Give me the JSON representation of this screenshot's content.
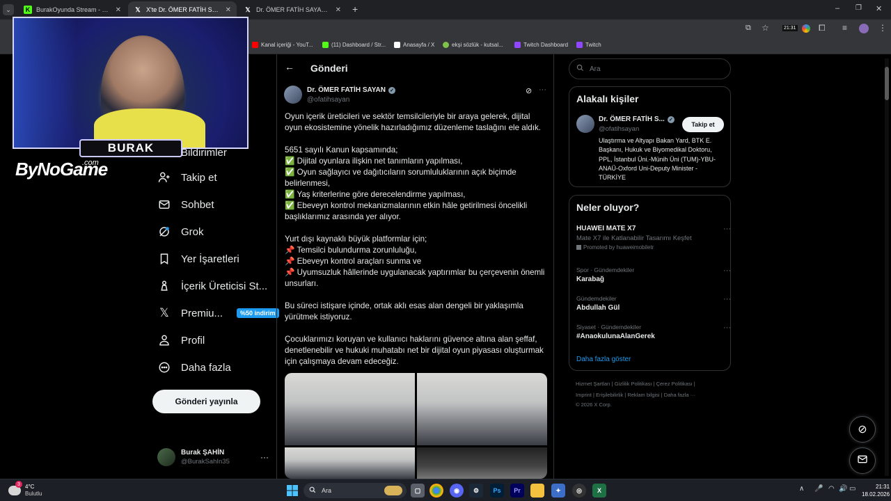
{
  "browser": {
    "tabs": [
      {
        "title": "BurakOyunda Stream - Watch L",
        "favicon": "twitch-kick-icon",
        "active": false
      },
      {
        "title": "X'te Dr. ÖMER FATİH SAYAN: \"O",
        "favicon": "x-logo-icon",
        "active": true
      },
      {
        "title": "Dr. ÖMER FATİH SAYAN (@ofat",
        "favicon": "x-logo-icon",
        "active": false
      }
    ],
    "new_tab": "+",
    "clock_badge": "21:31",
    "bookmarks": [
      {
        "label": "Kanal içeriği - YouT...",
        "color": "#ff0000"
      },
      {
        "label": "(11) Dashboard / Str...",
        "color": "#53fc18"
      },
      {
        "label": "Anasayfa / X",
        "color": "#ffffff"
      },
      {
        "label": "ekşi sözlük - kutsal...",
        "color": "#81c14b"
      },
      {
        "label": "Twitch Dashboard",
        "color": "#9146ff"
      },
      {
        "label": "Twitch",
        "color": "#9146ff"
      }
    ]
  },
  "sidebar": {
    "items": [
      {
        "label": "Takip et",
        "icon": "add-person-icon"
      },
      {
        "label": "Sohbet",
        "icon": "mail-icon"
      },
      {
        "label": "Grok",
        "icon": "grok-icon"
      },
      {
        "label": "Yer İşaretleri",
        "icon": "bookmark-icon"
      },
      {
        "label": "İçerik Üreticisi St...",
        "icon": "creator-studio-icon"
      },
      {
        "label": "Premiu...",
        "icon": "x-logo-icon"
      },
      {
        "label": "Profil",
        "icon": "person-icon"
      },
      {
        "label": "Daha fazla",
        "icon": "more-circle-icon"
      }
    ],
    "partial_item": "Bildirimler",
    "premium_badge": "%50 indirim",
    "post_button": "Gönderi yayınla",
    "account": {
      "name": "Burak ŞAHİN",
      "handle": "@BurakSahIn35"
    }
  },
  "post": {
    "header_title": "Gönderi",
    "author_name": "Dr. ÖMER FATİH SAYAN",
    "author_handle": "@ofatihsayan",
    "paragraphs": [
      "Oyun içerik üreticileri ve sektör temsilcileriyle bir araya gelerek, dijital oyun ekosistemine yönelik hazırladığımız düzenleme taslağını ele aldık.",
      "5651 sayılı Kanun kapsamında;\n✅ Dijital oyunlara ilişkin net tanımların yapılması,\n✅ Oyun sağlayıcı ve dağıtıcıların sorumluluklarının açık biçimde belirlenmesi,\n✅ Yaş kriterlerine göre derecelendirme yapılması,\n✅ Ebeveyn kontrol mekanizmalarının etkin hâle getirilmesi öncelikli başlıklarımız arasında yer alıyor.",
      "Yurt dışı kaynaklı büyük platformlar için;\n📌 Temsilci bulundurma zorunluluğu,\n📌 Ebeveyn kontrol araçları sunma ve\n📌 Uyumsuzluk hâllerinde uygulanacak yaptırımlar bu çerçevenin önemli unsurları.",
      "Bu süreci istişare içinde, ortak aklı esas alan dengeli bir yaklaşımla yürütmek istiyoruz.",
      "Çocuklarımızı koruyan ve kullanıcı haklarını güvence altına alan şeffaf, denetlenebilir ve hukuki muhatabı net bir dijital oyun piyasası oluşturmak için çalışmaya devam edeceğiz."
    ]
  },
  "right": {
    "search_placeholder": "Ara",
    "related_title": "Alakalı kişiler",
    "related_person": {
      "name": "Dr. ÖMER FATİH S...",
      "handle": "@ofatihsayan",
      "follow_label": "Takip et",
      "bio": "Ulaştırma ve Altyapı Bakan Yard, BTK E. Başkanı, Hukuk ve Biyomedikal Doktoru, PPL, İstanbul Üni.-Münih Üni (TUM)-YBU-ANAÜ-Oxford Uni-Deputy Minister - TÜRKİYE"
    },
    "trends_title": "Neler oluyor?",
    "trends": [
      {
        "meta": "",
        "name": "HUAWEI MATE X7",
        "sub": "Mate X7 ile Katlanabilir Tasarımı Keşfet",
        "promo": "Promoted by huaweimobiletr"
      },
      {
        "meta": "Spor · Gündemdekiler",
        "name": "Karabağ"
      },
      {
        "meta": "Gündemdekiler",
        "name": "Abdullah Gül"
      },
      {
        "meta": "Siyaset · Gündemdekiler",
        "name": "#AnaokulunaAlanGerek"
      }
    ],
    "show_more": "Daha fazla göster",
    "footer_line1": "Hizmet Şartları  |  Gizlilik Politikası  |  Çerez Politikası  |",
    "footer_line2": "Imprint  |  Erişilebilirlik  |  Reklam bilgisi  |  Daha fazla ···",
    "footer_line3": "© 2026 X Corp."
  },
  "stream_overlay": {
    "cam_name": "BURAK",
    "logo": "ByNoGame",
    "logo_com": ".com"
  },
  "taskbar": {
    "weather_temp": "4°C",
    "weather_desc": "Bulutlu",
    "search_label": "Ara",
    "time": "21:31",
    "date": "18.02.2026",
    "notif_count": "3"
  }
}
